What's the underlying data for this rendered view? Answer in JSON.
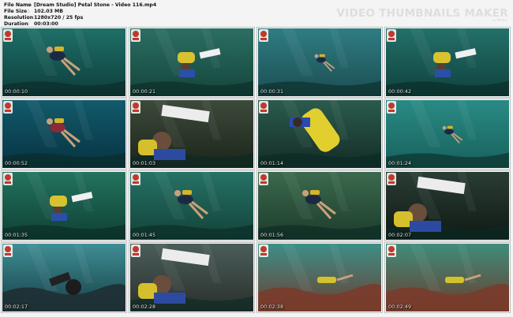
{
  "header": {
    "file_name_label": "File Name",
    "file_name": "[Dream Studio] Petal Stone - Video 116.mp4",
    "file_size_label": "File Size",
    "file_size": "102.03 MB",
    "resolution_label": "Resolution",
    "resolution": "1280x720 / 25 fps",
    "duration_label": "Duration",
    "duration": "00:03:00",
    "separator": ":",
    "brand": "VIDEO THUMBNAILS MAKER",
    "brand_sub": "by Media"
  },
  "thumbnails": [
    {
      "time": "00:00:10",
      "scene": "diver-swim",
      "bg": "#1f6f68",
      "bg2": "#0d3c3a"
    },
    {
      "time": "00:00:21",
      "scene": "diver-board",
      "bg": "#2b6f62",
      "bg2": "#14433b"
    },
    {
      "time": "00:00:31",
      "scene": "diver-far",
      "bg": "#2f7d82",
      "bg2": "#1a4d52"
    },
    {
      "time": "00:00:42",
      "scene": "diver-board",
      "bg": "#24706a",
      "bg2": "#0f403c"
    },
    {
      "time": "00:00:52",
      "scene": "diver-red",
      "bg": "#125a6b",
      "bg2": "#073241"
    },
    {
      "time": "00:01:03",
      "scene": "diver-close",
      "bg": "#3c4a3a",
      "bg2": "#1b241a"
    },
    {
      "time": "00:01:14",
      "scene": "tank-close",
      "bg": "#2b5b4e",
      "bg2": "#132b25"
    },
    {
      "time": "00:01:24",
      "scene": "diver-far",
      "bg": "#2a8a84",
      "bg2": "#17605c"
    },
    {
      "time": "00:01:35",
      "scene": "diver-board",
      "bg": "#23735f",
      "bg2": "#0e3f33"
    },
    {
      "time": "00:01:45",
      "scene": "diver-swim",
      "bg": "#267265",
      "bg2": "#124138"
    },
    {
      "time": "00:01:56",
      "scene": "diver-swim",
      "bg": "#3b6a4e",
      "bg2": "#1c3a29"
    },
    {
      "time": "00:02:07",
      "scene": "diver-close",
      "bg": "#2a3d34",
      "bg2": "#0f1813"
    },
    {
      "time": "00:02:17",
      "scene": "surface-dark",
      "bg": "#3f8e95",
      "bg2": "#163c43"
    },
    {
      "time": "00:02:28",
      "scene": "diver-close",
      "bg": "#4a5e5a",
      "bg2": "#2a2e2a"
    },
    {
      "time": "00:02:38",
      "scene": "reef",
      "bg": "#3d8f87",
      "bg2": "#6b3d30"
    },
    {
      "time": "00:02:49",
      "scene": "reef",
      "bg": "#3f8d7c",
      "bg2": "#6a3b2b"
    }
  ]
}
